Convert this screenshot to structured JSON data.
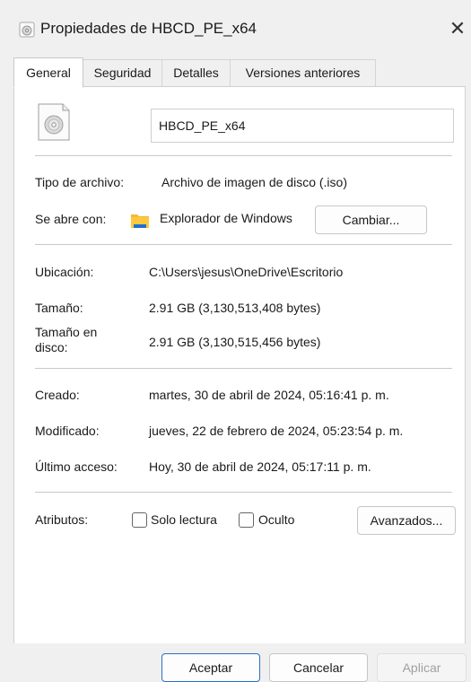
{
  "window": {
    "title": "Propiedades de HBCD_PE_x64",
    "close_glyph": "✕"
  },
  "tabs": [
    {
      "label": "General",
      "active": true
    },
    {
      "label": "Seguridad",
      "active": false
    },
    {
      "label": "Detalles",
      "active": false
    },
    {
      "label": "Versiones anteriores",
      "active": false
    }
  ],
  "general": {
    "file_name": "HBCD_PE_x64",
    "file_type_label": "Tipo de archivo:",
    "file_type_value": "Archivo de imagen de disco (.iso)",
    "opens_with_label": "Se abre con:",
    "opens_with_value": "Explorador de Windows",
    "change_button": "Cambiar...",
    "location_label": "Ubicación:",
    "location_value": "C:\\Users\\jesus\\OneDrive\\Escritorio",
    "size_label": "Tamaño:",
    "size_value": "2.91 GB (3,130,513,408 bytes)",
    "size_on_disk_label_1": "Tamaño en",
    "size_on_disk_label_2": "disco:",
    "size_on_disk_value": "2.91 GB (3,130,515,456 bytes)",
    "created_label": "Creado:",
    "created_value": "martes, 30 de abril de 2024, 05:16:41 p. m.",
    "modified_label": "Modificado:",
    "modified_value": "jueves, 22 de febrero de 2024, 05:23:54 p. m.",
    "accessed_label": "Último acceso:",
    "accessed_value": "Hoy, 30 de abril de 2024, 05:17:11 p. m.",
    "attributes_label": "Atributos:",
    "readonly_label": "Solo lectura",
    "readonly_checked": false,
    "hidden_label": "Oculto",
    "hidden_checked": false,
    "advanced_button": "Avanzados..."
  },
  "footer": {
    "ok_button": "Aceptar",
    "cancel_button": "Cancelar",
    "apply_button": "Aplicar"
  },
  "colors": {
    "accent": "#2a6fc9",
    "folder": "#f4b73b"
  }
}
